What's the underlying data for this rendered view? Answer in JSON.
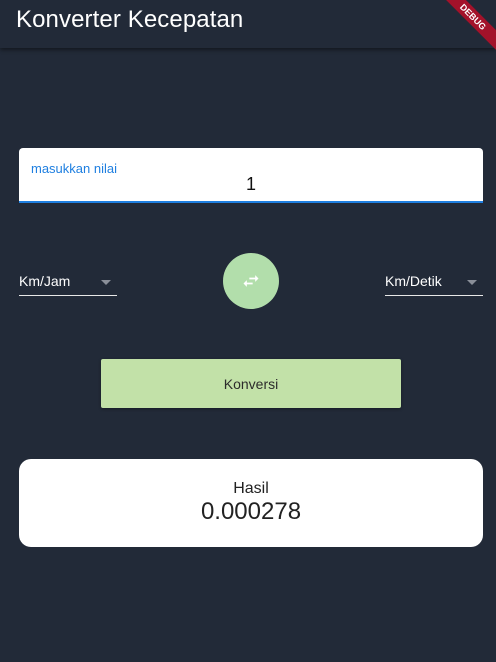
{
  "appbar": {
    "title": "Konverter Kecepatan"
  },
  "debug_banner": "DEBUG",
  "input": {
    "label": "masukkan nilai",
    "value": "1"
  },
  "from_unit": {
    "selected": "Km/Jam"
  },
  "to_unit": {
    "selected": "Km/Detik"
  },
  "swap": {
    "icon": "swap-horiz-icon"
  },
  "convert": {
    "label": "Konversi"
  },
  "result": {
    "label": "Hasil",
    "value": "0.000278"
  },
  "colors": {
    "background": "#222a38",
    "accent": "#1f7fe0",
    "swap_button": "#b2deab",
    "convert_button": "#c2e1a8",
    "debug_ribbon": "#a3122a"
  }
}
